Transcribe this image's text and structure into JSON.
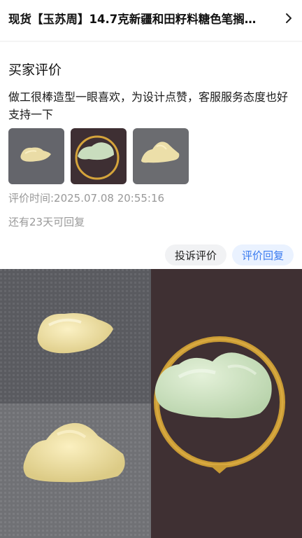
{
  "product": {
    "title": "现货【玉苏周】14.7克新疆和田籽料糖色笔搁…"
  },
  "icons": {
    "chevron": "chevron-right-icon"
  },
  "review": {
    "section_title": "买家评价",
    "text": "做工很棒造型一眼喜欢，为设计点赞，客服服务态度也好 支持一下",
    "time": "评价时间:2025.07.08 20:55:16",
    "reply_remaining": "还有23天可回复"
  },
  "actions": {
    "complain": "投诉评价",
    "reply": "评价回复"
  },
  "colors": {
    "accent_blue": "#3a7bf0",
    "gray_text": "#999999",
    "pill_gray_bg": "#f1f2f4",
    "pill_blue_bg": "#eaf2ff"
  }
}
